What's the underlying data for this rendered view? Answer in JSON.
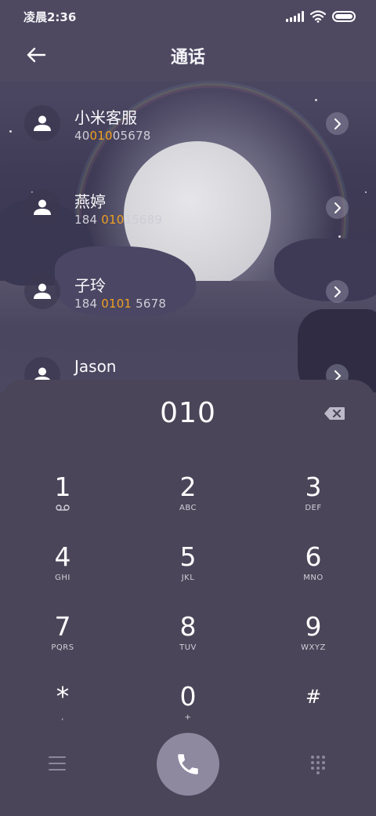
{
  "status_bar": {
    "time": "凌晨2:36"
  },
  "header": {
    "title": "通话"
  },
  "contacts": [
    {
      "name": "小米客服",
      "number_pre": "40",
      "number_match": "010",
      "number_post": "05678"
    },
    {
      "name": "燕婷",
      "number_pre": "184 ",
      "number_match": "010",
      "number_post": "15689"
    },
    {
      "name": "子玲",
      "number_pre": "184 ",
      "number_match": "0101",
      "number_post": " 5678"
    },
    {
      "name": "Jason",
      "number_pre": "",
      "number_match": "",
      "number_post": ""
    }
  ],
  "dialer": {
    "input": "010",
    "keys": [
      {
        "digit": "1",
        "letters": "voicemail-icon"
      },
      {
        "digit": "2",
        "letters": "ABC"
      },
      {
        "digit": "3",
        "letters": "DEF"
      },
      {
        "digit": "4",
        "letters": "GHI"
      },
      {
        "digit": "5",
        "letters": "JKL"
      },
      {
        "digit": "6",
        "letters": "MNO"
      },
      {
        "digit": "7",
        "letters": "PQRS"
      },
      {
        "digit": "8",
        "letters": "TUV"
      },
      {
        "digit": "9",
        "letters": "WXYZ"
      },
      {
        "digit": "*",
        "letters": ","
      },
      {
        "digit": "0",
        "letters": "+"
      },
      {
        "digit": "#",
        "letters": ""
      }
    ]
  },
  "colors": {
    "highlight": "#f0a020",
    "dialpad_bg": "#4b4559",
    "call_button": "#8f89a0"
  }
}
